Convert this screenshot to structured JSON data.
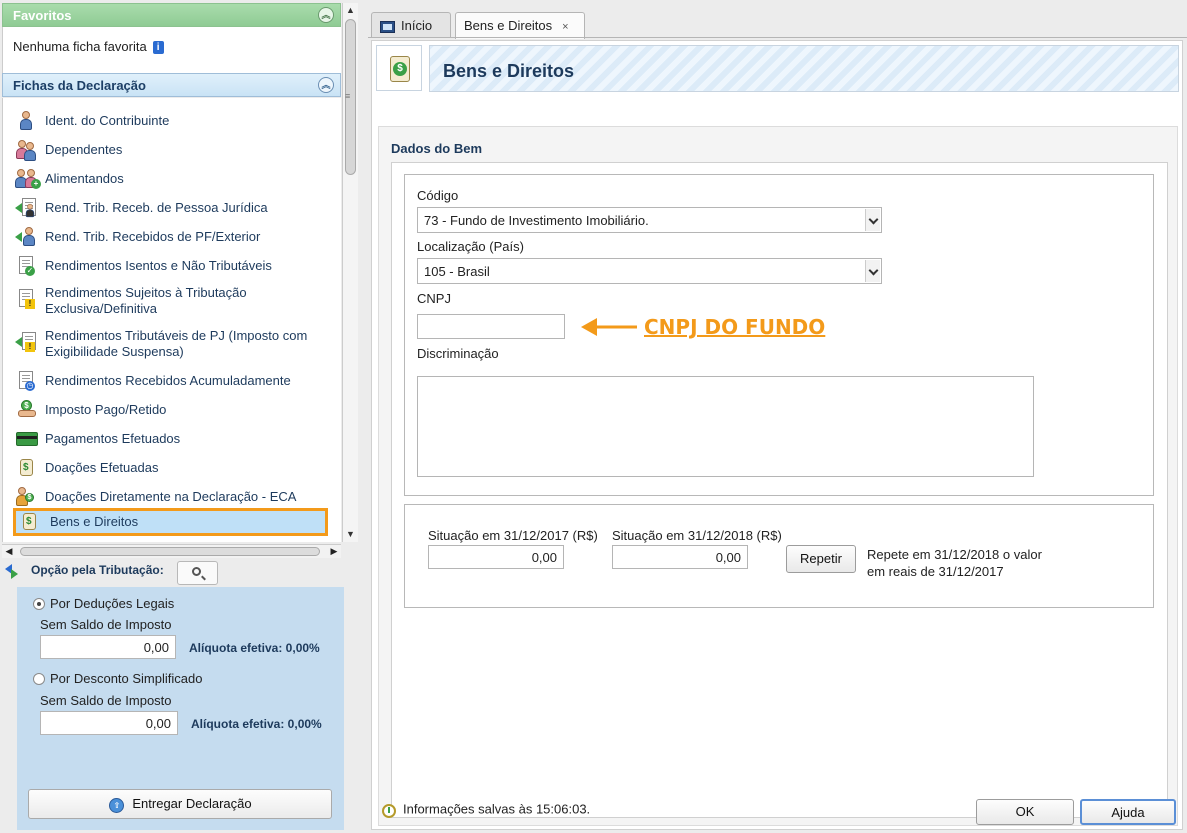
{
  "sidebar": {
    "favoritos": {
      "title": "Favoritos",
      "empty_text": "Nenhuma ficha favorita"
    },
    "fichas": {
      "title": "Fichas da Declaração",
      "items": [
        {
          "label": "Ident. do Contribuinte",
          "icon": "person-icon"
        },
        {
          "label": "Dependentes",
          "icon": "people-icon"
        },
        {
          "label": "Alimentandos",
          "icon": "people-add-icon"
        },
        {
          "label": "Rend. Trib. Receb. de Pessoa Jurídica",
          "icon": "income-pj-icon"
        },
        {
          "label": "Rend. Trib. Recebidos de PF/Exterior",
          "icon": "income-pf-icon"
        },
        {
          "label": "Rendimentos Isentos e Não Tributáveis",
          "icon": "doc-check-icon"
        },
        {
          "label": "Rendimentos Sujeitos à Tributação",
          "label2": "Exclusiva/Definitiva",
          "icon": "doc-warning-icon"
        },
        {
          "label": "Rendimentos Tributáveis de PJ (Imposto com",
          "label2": "Exigibilidade Suspensa)",
          "icon": "income-suspended-icon"
        },
        {
          "label": "Rendimentos Recebidos Acumuladamente",
          "icon": "doc-clock-icon"
        },
        {
          "label": "Imposto Pago/Retido",
          "icon": "hand-coin-icon"
        },
        {
          "label": "Pagamentos Efetuados",
          "icon": "card-icon"
        },
        {
          "label": "Doações Efetuadas",
          "icon": "money-bag-icon"
        },
        {
          "label": "Doações Diretamente na Declaração - ECA",
          "icon": "people-donation-icon"
        },
        {
          "label": "Bens e Direitos",
          "icon": "money-doc-icon",
          "selected": true
        }
      ]
    }
  },
  "tributacao": {
    "label": "Opção pela Tributação:",
    "deducoes": {
      "label": "Por Deduções Legais",
      "checked": true,
      "saldo_label": "Sem Saldo de Imposto",
      "value": "0,00",
      "aliquota": "Alíquota efetiva: 0,00%"
    },
    "simplificado": {
      "label": "Por Desconto Simplificado",
      "checked": false,
      "saldo_label": "Sem Saldo de Imposto",
      "value": "0,00",
      "aliquota": "Alíquota efetiva: 0,00%"
    },
    "entregar_label": "Entregar Declaração"
  },
  "tabs": [
    {
      "label": "Início",
      "active": false
    },
    {
      "label": "Bens e Direitos",
      "active": true,
      "close": "×"
    }
  ],
  "page": {
    "title": "Bens e Direitos",
    "section_title": "Dados do Bem",
    "codigo": {
      "label": "Código",
      "value": "73 - Fundo de Investimento Imobiliário."
    },
    "localizacao": {
      "label": "Localização (País)",
      "value": "105 - Brasil"
    },
    "cnpj": {
      "label": "CNPJ",
      "value": "",
      "annotation": "CNPJ DO FUNDO"
    },
    "discriminacao": {
      "label": "Discriminação",
      "value": ""
    },
    "situacao_2017": {
      "label": "Situação em 31/12/2017 (R$)",
      "value": "0,00"
    },
    "situacao_2018": {
      "label": "Situação em 31/12/2018 (R$)",
      "value": "0,00"
    },
    "repetir_label": "Repetir",
    "repetir_note_1": "Repete em 31/12/2018 o valor",
    "repetir_note_2": "em reais de 31/12/2017"
  },
  "footer": {
    "status": "Informações salvas às 15:06:03.",
    "ok_label": "OK",
    "ajuda_label": "Ajuda"
  },
  "colors": {
    "accent_orange": "#f39a1a",
    "header_blue": "#1d3a5c",
    "favoritos_green": "#8fcb94",
    "tributacao_panel": "#c5dcef"
  }
}
